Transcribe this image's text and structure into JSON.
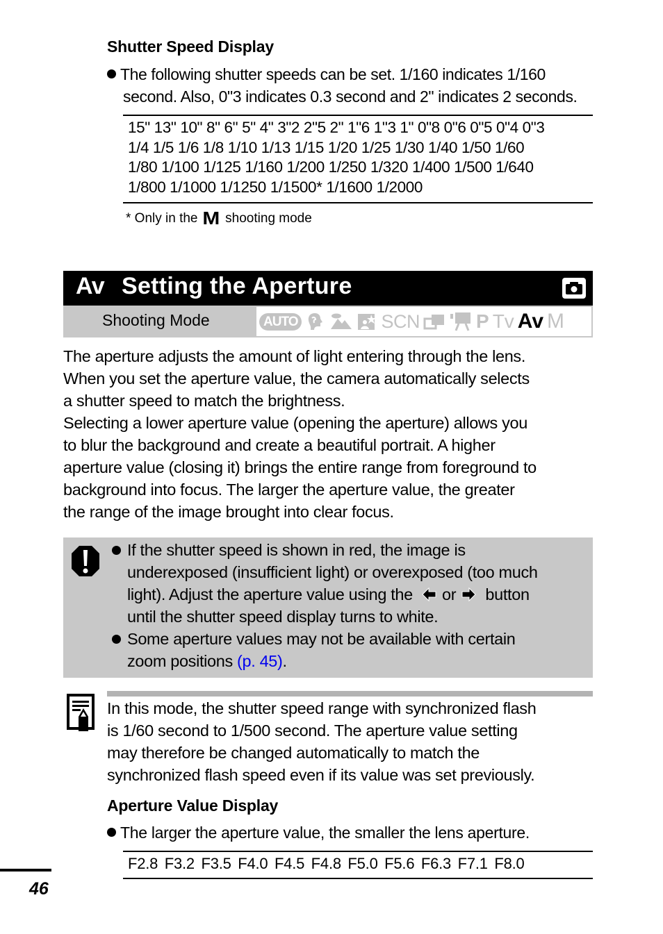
{
  "shutter_section": {
    "heading": "Shutter Speed Display",
    "bullet": "The following shutter speeds can be set. 1/160 indicates 1/160 second. Also, 0\"3 indicates 0.3 second and 2\" indicates 2 seconds.",
    "bullet_line1": "The following shutter speeds can be set. 1/160 indicates 1/160",
    "bullet_line2": "second. Also, 0\"3 indicates 0.3 second and 2\" indicates 2 seconds.",
    "speed_rows": [
      "15\" 13\" 10\" 8\" 6\" 5\" 4\" 3\"2 2\"5 2\" 1\"6 1\"3 1\" 0\"8 0\"6 0\"5 0\"4 0\"3",
      "1/4 1/5 1/6 1/8 1/10 1/13 1/15 1/20 1/25 1/30 1/40 1/50 1/60",
      "1/80 1/100 1/125 1/160 1/200 1/250 1/320 1/400 1/500 1/640",
      "1/800 1/1000 1/1250 1/1500* 1/1600 1/2000"
    ],
    "footnote_prefix": "* Only in the",
    "footnote_mode_glyph": "M",
    "footnote_suffix": "shooting mode"
  },
  "title_bar": {
    "mode_prefix": "Av",
    "title": "Setting the Aperture",
    "icon": "camera-icon"
  },
  "shooting_mode": {
    "label": "Shooting Mode",
    "modes": [
      {
        "name": "AUTO",
        "icon": "auto-icon",
        "active": false
      },
      {
        "name": "Portrait",
        "icon": "portrait-icon",
        "active": false
      },
      {
        "name": "Landscape",
        "icon": "landscape-icon",
        "active": false
      },
      {
        "name": "Night Scene",
        "icon": "night-scene-icon",
        "active": false
      },
      {
        "name": "SCN",
        "icon": "scn-icon",
        "active": false
      },
      {
        "name": "Stitch Assist",
        "icon": "stitch-assist-icon",
        "active": false
      },
      {
        "name": "Movie",
        "icon": "movie-icon",
        "active": false
      },
      {
        "name": "P",
        "icon": "p-mode-icon",
        "active": false
      },
      {
        "name": "Tv",
        "icon": "tv-mode-icon",
        "active": false
      },
      {
        "name": "Av",
        "icon": "av-mode-icon",
        "active": true
      },
      {
        "name": "M",
        "icon": "m-mode-icon",
        "active": false
      }
    ],
    "inactive_color": "#c3c3c3",
    "active_color": "#000000"
  },
  "body": {
    "lines": [
      "The aperture adjusts the amount of light entering through the lens.",
      "When you set the aperture value, the camera automatically selects",
      "a shutter speed to match the brightness.",
      "Selecting a lower aperture value (opening the aperture) allows you",
      "to blur the background and create a beautiful portrait. A higher",
      "aperture value (closing it) brings the entire range from foreground to",
      "background into focus. The larger the aperture value, the greater",
      "the range of the image brought into clear focus."
    ]
  },
  "caution": {
    "icon": "caution-icon",
    "item1_line1": "If the shutter speed is shown in red, the image is",
    "item1_line2": "underexposed (insufficient light) or overexposed (too much",
    "item1_line3_a": "light). Adjust the aperture value using the",
    "item1_line3_or": "or",
    "item1_line3_b": "button",
    "item1_line4": "until the shutter speed display turns to white.",
    "item2_line1": "Some aperture values may not be available with certain",
    "item2_line2_a": "zoom positions",
    "item2_link": "(p. 45)",
    "item2_line2_b": ".",
    "link_color": "#0000ee"
  },
  "note": {
    "icon": "memo-icon",
    "lines": [
      "In this mode, the shutter speed range with synchronized flash",
      "is 1/60 second to 1/500 second. The aperture value setting",
      "may therefore be changed automatically to match the",
      "synchronized flash speed even if its value was set previously."
    ]
  },
  "aperture_section": {
    "heading": "Aperture Value Display",
    "bullet": "The larger the aperture value, the smaller the lens aperture.",
    "values": [
      "F2.8",
      "F3.2",
      "F3.5",
      "F4.0",
      "F4.5",
      "F4.8",
      "F5.0",
      "F5.6",
      "F6.3",
      "F7.1",
      "F8.0"
    ]
  },
  "page_number": "46"
}
